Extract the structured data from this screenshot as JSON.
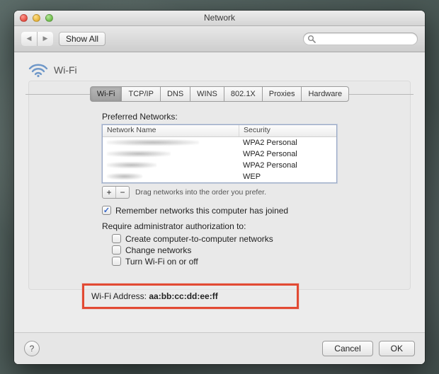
{
  "window": {
    "title": "Network"
  },
  "toolbar": {
    "show_all": "Show All",
    "search_placeholder": ""
  },
  "header": {
    "interface": "Wi-Fi"
  },
  "tabs": [
    "Wi-Fi",
    "TCP/IP",
    "DNS",
    "WINS",
    "802.1X",
    "Proxies",
    "Hardware"
  ],
  "active_tab_index": 0,
  "preferred": {
    "label": "Preferred Networks:",
    "columns": [
      "Network Name",
      "Security"
    ],
    "rows": [
      {
        "security": "WPA2 Personal"
      },
      {
        "security": "WPA2 Personal"
      },
      {
        "security": "WPA2 Personal"
      },
      {
        "security": "WEP"
      }
    ],
    "drag_hint": "Drag networks into the order you prefer."
  },
  "remember": {
    "checked": true,
    "label": "Remember networks this computer has joined"
  },
  "admin": {
    "label": "Require administrator authorization to:",
    "options": [
      {
        "checked": false,
        "label": "Create computer-to-computer networks"
      },
      {
        "checked": false,
        "label": "Change networks"
      },
      {
        "checked": false,
        "label": "Turn Wi-Fi on or off"
      }
    ]
  },
  "wifi_address": {
    "label": "Wi-Fi Address:",
    "value": "aa:bb:cc:dd:ee:ff"
  },
  "buttons": {
    "cancel": "Cancel",
    "ok": "OK",
    "help": "?"
  },
  "colors": {
    "highlight": "#e24a33",
    "accent": "#3264c8"
  }
}
